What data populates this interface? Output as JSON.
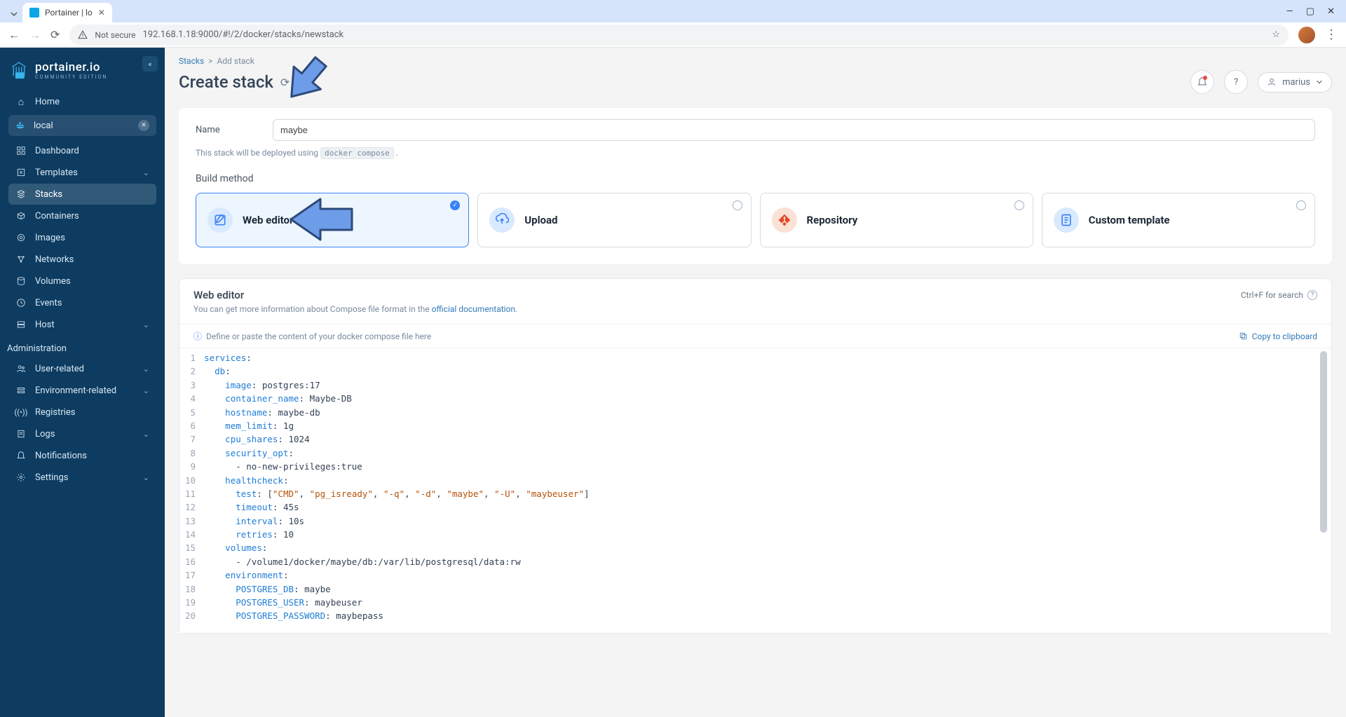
{
  "browser": {
    "tab_title": "Portainer | lo",
    "secure_label": "Not secure",
    "url": "192.168.1.18:9000/#!/2/docker/stacks/newstack"
  },
  "sidebar": {
    "logo": "portainer.io",
    "logo_sub": "COMMUNITY EDITION",
    "home": "Home",
    "env_label": "local",
    "items": [
      {
        "icon": "dashboard",
        "label": "Dashboard"
      },
      {
        "icon": "templates",
        "label": "Templates",
        "chev": true
      },
      {
        "icon": "stacks",
        "label": "Stacks",
        "active": true
      },
      {
        "icon": "containers",
        "label": "Containers"
      },
      {
        "icon": "images",
        "label": "Images"
      },
      {
        "icon": "networks",
        "label": "Networks"
      },
      {
        "icon": "volumes",
        "label": "Volumes"
      },
      {
        "icon": "events",
        "label": "Events"
      },
      {
        "icon": "host",
        "label": "Host",
        "chev": true
      }
    ],
    "admin_label": "Administration",
    "admin_items": [
      {
        "icon": "users",
        "label": "User-related",
        "chev": true
      },
      {
        "icon": "env",
        "label": "Environment-related",
        "chev": true
      },
      {
        "icon": "registries",
        "label": "Registries"
      },
      {
        "icon": "logs",
        "label": "Logs",
        "chev": true
      },
      {
        "icon": "notifications",
        "label": "Notifications"
      },
      {
        "icon": "settings",
        "label": "Settings",
        "chev": true
      }
    ]
  },
  "page": {
    "breadcrumb_root": "Stacks",
    "breadcrumb_current": "Add stack",
    "title": "Create stack",
    "user": "marius",
    "name_label": "Name",
    "name_value": "maybe",
    "deploy_hint_pre": "This stack will be deployed using ",
    "deploy_hint_code": "docker compose",
    "deploy_hint_post": " .",
    "build_label": "Build method",
    "build_options": [
      {
        "id": "web-editor",
        "label": "Web editor",
        "icon_bg": "#d9eaff",
        "icon_fg": "#3b82f6"
      },
      {
        "id": "upload",
        "label": "Upload",
        "icon_bg": "#d9eaff",
        "icon_fg": "#3b82f6"
      },
      {
        "id": "repository",
        "label": "Repository",
        "icon_bg": "#fbe2d6",
        "icon_fg": "#e34c26"
      },
      {
        "id": "custom-template",
        "label": "Custom template",
        "icon_bg": "#d9eaff",
        "icon_fg": "#3b82f6"
      }
    ]
  },
  "editor": {
    "title": "Web editor",
    "search_hint": "Ctrl+F for search",
    "sub_text_pre": "You can get more information about Compose file format in the ",
    "sub_link": "official documentation",
    "sub_text_post": ".",
    "define_hint": "Define or paste the content of your docker compose file here",
    "copy_label": "Copy to clipboard"
  },
  "code": {
    "lines": [
      {
        "n": 1,
        "html": "<span class='tok-key'>services</span>:"
      },
      {
        "n": 2,
        "html": "  <span class='tok-key'>db</span>:"
      },
      {
        "n": 3,
        "html": "    <span class='tok-key'>image</span>: postgres:17"
      },
      {
        "n": 4,
        "html": "    <span class='tok-key'>container_name</span>: Maybe-DB"
      },
      {
        "n": 5,
        "html": "    <span class='tok-key'>hostname</span>: maybe-db"
      },
      {
        "n": 6,
        "html": "    <span class='tok-key'>mem_limit</span>: 1g"
      },
      {
        "n": 7,
        "html": "    <span class='tok-key'>cpu_shares</span>: 1024"
      },
      {
        "n": 8,
        "html": "    <span class='tok-key'>security_opt</span>:"
      },
      {
        "n": 9,
        "html": "      - no-new-privileges:true"
      },
      {
        "n": 10,
        "html": "    <span class='tok-key'>healthcheck</span>:"
      },
      {
        "n": 11,
        "html": "      <span class='tok-key'>test</span>: [<span class='tok-str'>\"CMD\"</span>, <span class='tok-str'>\"pg_isready\"</span>, <span class='tok-str'>\"-q\"</span>, <span class='tok-str'>\"-d\"</span>, <span class='tok-str'>\"maybe\"</span>, <span class='tok-str'>\"-U\"</span>, <span class='tok-str'>\"maybeuser\"</span>]"
      },
      {
        "n": 12,
        "html": "      <span class='tok-key'>timeout</span>: 45s"
      },
      {
        "n": 13,
        "html": "      <span class='tok-key'>interval</span>: 10s"
      },
      {
        "n": 14,
        "html": "      <span class='tok-key'>retries</span>: 10"
      },
      {
        "n": 15,
        "html": "    <span class='tok-key'>volumes</span>:"
      },
      {
        "n": 16,
        "html": "      - /volume1/docker/maybe/db:/var/lib/postgresql/data:rw"
      },
      {
        "n": 17,
        "html": "    <span class='tok-key'>environment</span>:"
      },
      {
        "n": 18,
        "html": "      <span class='tok-key'>POSTGRES_DB</span>: maybe"
      },
      {
        "n": 19,
        "html": "      <span class='tok-key'>POSTGRES_USER</span>: maybeuser"
      },
      {
        "n": 20,
        "html": "      <span class='tok-key'>POSTGRES_PASSWORD</span>: maybepass"
      }
    ]
  }
}
